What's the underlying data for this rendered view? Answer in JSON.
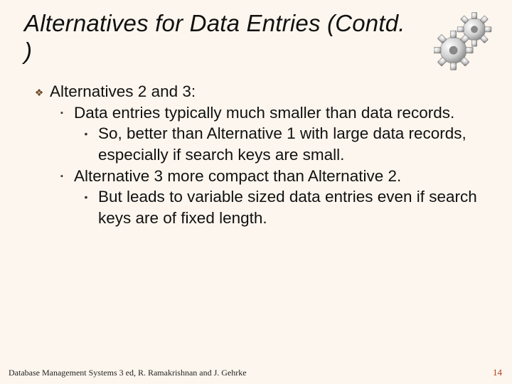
{
  "title": "Alternatives for Data Entries (Contd. )",
  "bullets": {
    "l1": "Alternatives 2 and 3:",
    "l2a": "Data entries typically much smaller than data records.",
    "l3a": "So, better than Alternative 1 with large data records, especially if search keys are small.",
    "l2b": "Alternative 3 more compact than Alternative 2.",
    "l3b": "But leads to variable sized data entries even if search keys are of fixed length."
  },
  "glyphs": {
    "diamond": "❖",
    "square": "▪",
    "dot": "•"
  },
  "footer": "Database Management Systems 3 ed, R. Ramakrishnan and J. Gehrke",
  "page": "14"
}
